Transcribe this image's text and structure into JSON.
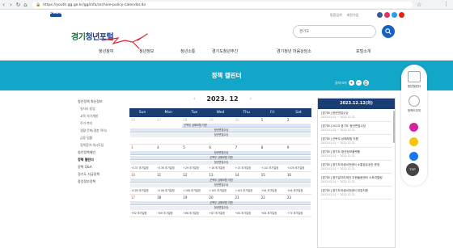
{
  "browser": {
    "url": "https://youth.gg.go.kr/gg/info/archive-policy-calendar.do"
  },
  "header": {
    "gov_logo_text": "경기도",
    "top_links": [
      "통합검색",
      "회원가입"
    ],
    "site_logo_lead": "경기",
    "site_logo_tail": "청년포털",
    "search_value": "경기도"
  },
  "gnb": [
    "청년참여",
    "청년정보",
    "청년소통",
    "경기도청년주간",
    "경기청년 마음상담소",
    "포털소개"
  ],
  "hero": {
    "title": "정책 캘린더"
  },
  "font_size": {
    "label": "글자크기"
  },
  "lnb": {
    "items": [
      {
        "label": "청년정책 최신정보",
        "type": "main"
      },
      {
        "label": "일자리·창업",
        "type": "sub"
      },
      {
        "label": "교육·자기계발",
        "type": "sub"
      },
      {
        "label": "주거·복지",
        "type": "sub"
      },
      {
        "label": "생활·문화(결혼·육아)",
        "type": "sub"
      },
      {
        "label": "금융·법률",
        "type": "sub"
      },
      {
        "label": "정책참여·게시모집",
        "type": "sub"
      },
      {
        "label": "청년정책제안",
        "type": "main"
      },
      {
        "label": "정책 캘린더",
        "type": "main on"
      },
      {
        "label": "정책 Q&A",
        "type": "main"
      },
      {
        "label": "경기도 지급정책",
        "type": "main"
      },
      {
        "label": "중앙정부정책",
        "type": "main"
      }
    ]
  },
  "calendar": {
    "title": "2023. 12",
    "weekdays": [
      "Sun",
      "Mon",
      "Tue",
      "Wed",
      "Thu",
      "Fri",
      "Sat"
    ],
    "weeks": [
      {
        "dates": [
          "26",
          "27",
          "28",
          "29",
          "30",
          "1",
          "2"
        ],
        "dim": [
          true,
          true,
          true,
          true,
          true,
          false,
          false
        ],
        "bars": [
          {
            "label": "군복무 상해보험 지원",
            "start": 2,
            "span": 5,
            "style": "blue"
          },
          {
            "label": "청년면접수당",
            "start": 0,
            "span": 7,
            "style": "blue"
          },
          {
            "label": "청년면접수당",
            "start": 0,
            "span": 7,
            "style": "gray"
          }
        ],
        "chips": [
          "",
          "",
          "",
          "",
          "",
          "",
          ""
        ]
      },
      {
        "dates": [
          "3",
          "4",
          "5",
          "6",
          "7",
          "8",
          "9"
        ],
        "dim": [
          false,
          false,
          false,
          false,
          false,
          false,
          false
        ],
        "bars": [
          {
            "label": "청년면접수당",
            "start": 0,
            "span": 7,
            "style": "blue"
          },
          {
            "label": "군복무 상해보험 지원",
            "start": 0,
            "span": 7,
            "style": "blue"
          },
          {
            "label": "청년면접수당",
            "start": 0,
            "span": 7,
            "style": "gray"
          }
        ],
        "chips": [
          "+137 추가일정",
          "+136 추가일정",
          "+29 추가일정",
          "+16 추가일정",
          "+13 추가일정",
          "+110 추가일정",
          "+109 추가일정"
        ]
      },
      {
        "dates": [
          "10",
          "11",
          "12",
          "13",
          "14",
          "15",
          "16"
        ],
        "dim": [
          false,
          false,
          false,
          false,
          false,
          false,
          false
        ],
        "bars": [
          {
            "label": "군복무 상해보험 지원",
            "start": 0,
            "span": 7,
            "style": "blue"
          },
          {
            "label": "청년면접수당",
            "start": 0,
            "span": 7,
            "style": "gray"
          }
        ],
        "chips": [
          "+109 추가일정",
          "+106 추가일정",
          "+108 추가일정",
          "+105 추가일정",
          "+103 추가일정",
          "+94 추가일정",
          "+94 추가일정"
        ]
      },
      {
        "dates": [
          "17",
          "18",
          "19",
          "20",
          "21",
          "22",
          "23"
        ],
        "dim": [
          false,
          false,
          false,
          false,
          false,
          false,
          false
        ],
        "bars": [
          {
            "label": "군복무 상해보험 지원",
            "start": 0,
            "span": 7,
            "style": "blue"
          },
          {
            "label": "청년면접수당",
            "start": 0,
            "span": 7,
            "style": "gray"
          }
        ],
        "chips": [
          "+92 추가일정",
          "+89 추가일정",
          "+86 추가일정",
          "+87 추가일정",
          "+84 추가일정",
          "+84 추가일정",
          "+75 추가일정"
        ]
      }
    ]
  },
  "event_panel": {
    "date": "2023.12.12(화)",
    "events": [
      {
        "title": "[경기도] 청년면접수당",
        "date": "2023-01-01 ~ 2023-12-31"
      },
      {
        "title": "[경기도] 2023 경기도 청년면접수당",
        "date": "2023-01-02 ~ 2023-12-31"
      },
      {
        "title": "[경기도] 군복무 상해보험 지원",
        "date": "2023-01-01 ~ 2023-12-31"
      },
      {
        "title": "[경기도] 경기도 청년정보플랫폼",
        "date": "2023-01-01 ~ 2023-12-31"
      },
      {
        "title": "[경기도] 경기도여성비전센터 소통공유공간 운영",
        "date": "2023-01-01 ~ 2023-12-31"
      },
      {
        "title": "[경기도] 경기일자리재단 무한돌봄센터 스토리텔링",
        "date": "2023-02-01 ~ 2023-12-31"
      },
      {
        "title": "[경기도] 경기도여성비전센터 취업지원",
        "date": "2023-01-01 ~ 2023-12-31"
      }
    ]
  },
  "right_quick": {
    "items": [
      "청년캘린더",
      "정책도우미"
    ],
    "top_label": "TOP"
  }
}
